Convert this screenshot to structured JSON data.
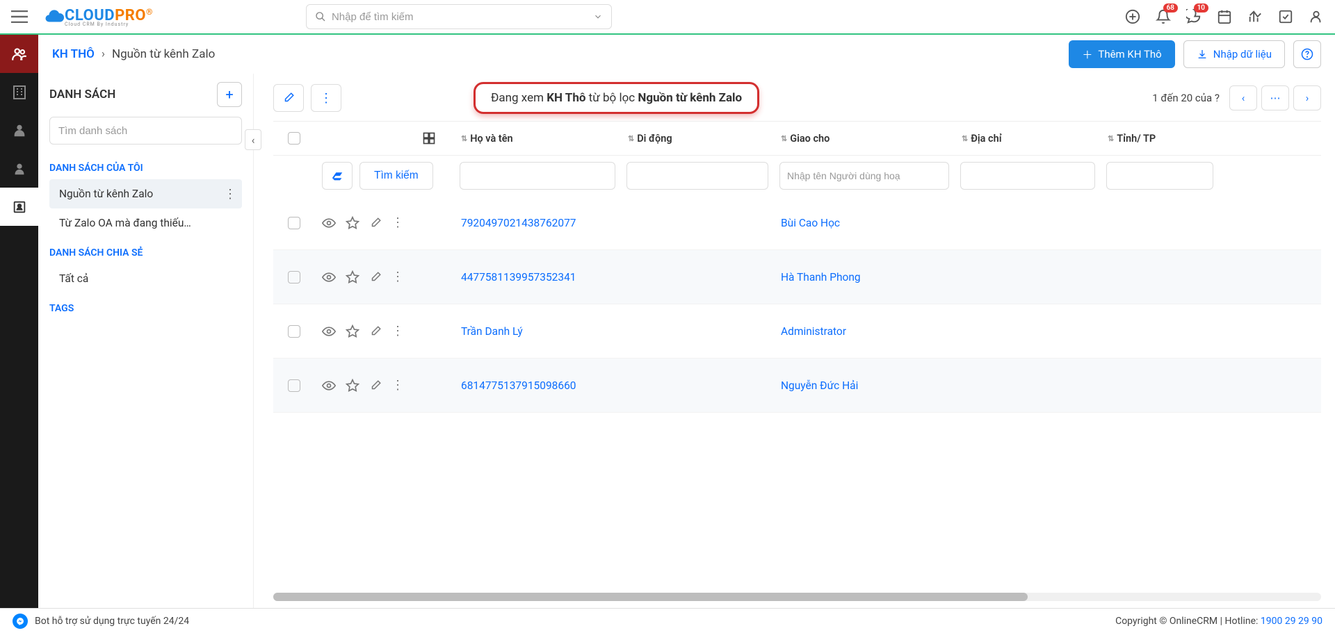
{
  "header": {
    "logo_cloud": "CLOUD",
    "logo_pro": "PRO",
    "logo_sub": "Cloud CRM By Industry",
    "search_placeholder": "Nhập để tìm kiếm",
    "badge_bell": "68",
    "badge_chat": "10"
  },
  "breadcrumb": {
    "main": "KH THÔ",
    "sub": "Nguồn từ kênh Zalo",
    "add_btn": "Thêm KH Thô",
    "import_btn": "Nhập dữ liệu"
  },
  "sidebar": {
    "title": "DANH SÁCH",
    "search_placeholder": "Tìm danh sách",
    "sec_my": "DANH SÁCH CỦA TÔI",
    "my_items": [
      "Nguồn từ kênh Zalo",
      "Từ Zalo OA mà đang thiếu…"
    ],
    "sec_shared": "DANH SÁCH CHIA SẺ",
    "shared_items": [
      "Tất cả"
    ],
    "sec_tags": "TAGS"
  },
  "filter_msg": {
    "prefix": "Đang xem ",
    "entity": "KH Thô",
    "mid": " từ bộ lọc ",
    "name": "Nguồn từ kênh Zalo"
  },
  "pager": {
    "text": "1 đến 20 của  ?"
  },
  "columns": {
    "name": "Họ và tên",
    "mobile": "Di động",
    "assign": "Giao cho",
    "addr": "Địa chỉ",
    "city": "Tỉnh/ TP"
  },
  "filters": {
    "search_btn": "Tìm kiếm",
    "assign_placeholder": "Nhập tên Người dùng hoạ"
  },
  "rows": [
    {
      "name": "7920497021438762077",
      "assign": "Bùi Cao Học"
    },
    {
      "name": "4477581139957352341",
      "assign": "Hà Thanh Phong"
    },
    {
      "name": "Trần Danh Lý",
      "assign": "Administrator"
    },
    {
      "name": "6814775137915098660",
      "assign": "Nguyễn Đức Hải"
    }
  ],
  "footer": {
    "bot": "Bot hỗ trợ sử dụng trực tuyến 24/24",
    "copyright": "Copyright © OnlineCRM",
    "hotline_label": "Hotline:",
    "hotline": "1900 29 29 90"
  }
}
